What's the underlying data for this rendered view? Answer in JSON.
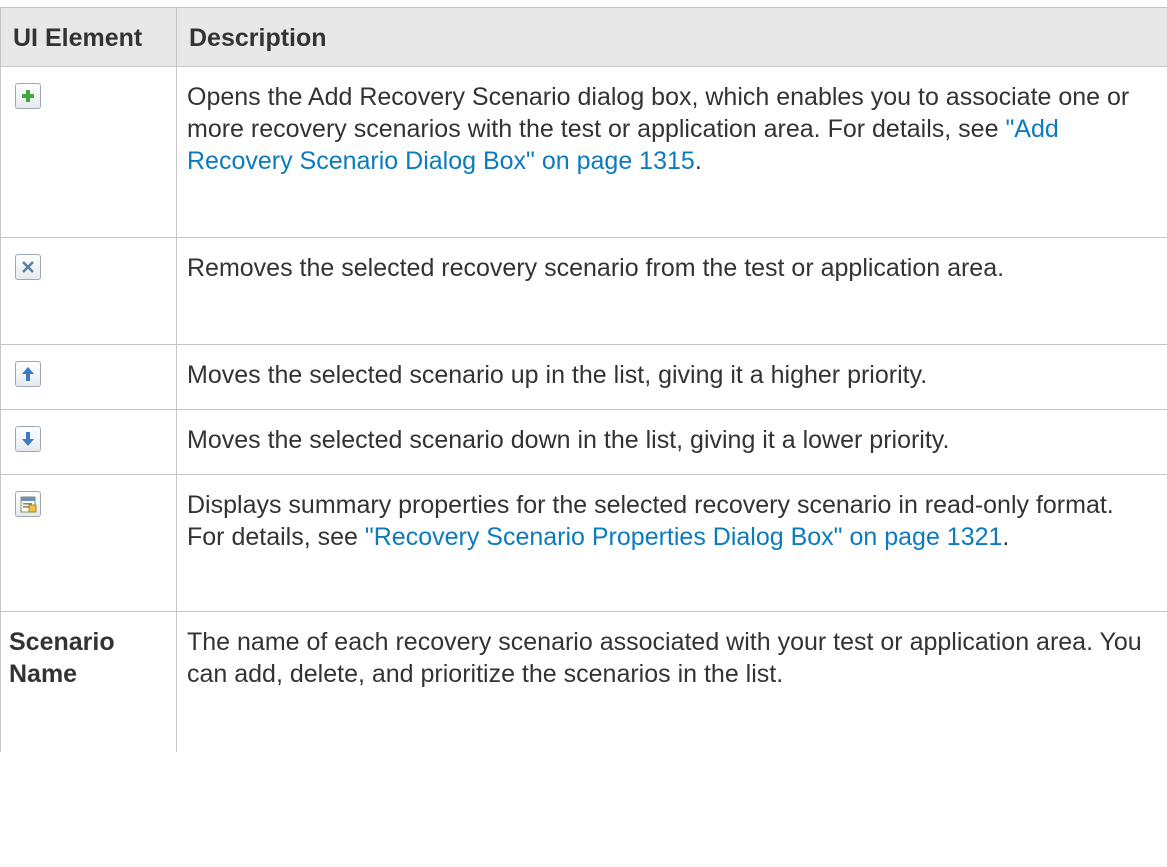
{
  "header": {
    "col_ui_element": "UI Element",
    "col_description": "Description"
  },
  "rows": [
    {
      "icon": "add-icon",
      "desc_text": "Opens the Add Recovery Scenario dialog box, which enables you to associate one or more recovery scenarios with the test or application area. For details, see ",
      "desc_link": "\"Add Recovery Scenario Dialog Box\" on page 1315",
      "desc_end": "."
    },
    {
      "icon": "remove-icon",
      "desc_text": "Removes the selected recovery scenario from the test or application area."
    },
    {
      "icon": "move-up-icon",
      "desc_text": "Moves the selected scenario up in the list, giving it a higher priority."
    },
    {
      "icon": "move-down-icon",
      "desc_text": "Moves the selected scenario down in the list, giving it a lower priority."
    },
    {
      "icon": "properties-icon",
      "desc_text": "Displays summary properties for the selected recovery scenario in read-only format. For details, see ",
      "desc_link": "\"Recovery Scenario Properties Dialog Box\" on page 1321",
      "desc_end": "."
    },
    {
      "name": "Scenario Name",
      "desc_text": "The name of each recovery scenario associated with your test or application area. You can add, delete, and prioritize the scenarios in the list."
    }
  ]
}
